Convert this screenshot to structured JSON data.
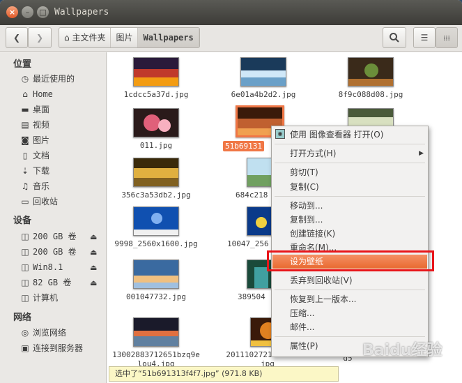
{
  "window": {
    "title": "Wallpapers"
  },
  "toolbar": {
    "breadcrumbs": [
      "主文件夹",
      "图片",
      "Wallpapers"
    ],
    "back_icon": "chevron-left-icon",
    "forward_icon": "chevron-right-icon",
    "search_icon": "search-icon"
  },
  "sidebar": {
    "places_heading": "位置",
    "places": [
      {
        "label": "最近使用的",
        "icon": "clock-icon"
      },
      {
        "label": "Home",
        "icon": "home-icon"
      },
      {
        "label": "桌面",
        "icon": "folder-icon"
      },
      {
        "label": "视频",
        "icon": "video-icon"
      },
      {
        "label": "图片",
        "icon": "camera-icon"
      },
      {
        "label": "文档",
        "icon": "document-icon"
      },
      {
        "label": "下载",
        "icon": "download-icon"
      },
      {
        "label": "音乐",
        "icon": "music-icon"
      },
      {
        "label": "回收站",
        "icon": "trash-icon"
      }
    ],
    "devices_heading": "设备",
    "devices": [
      {
        "label": "200 GB 卷",
        "icon": "drive-icon",
        "eject": true
      },
      {
        "label": "200 GB 卷",
        "icon": "drive-icon",
        "eject": true
      },
      {
        "label": "Win8.1",
        "icon": "drive-icon",
        "eject": true
      },
      {
        "label": "82 GB 卷",
        "icon": "drive-icon",
        "eject": true
      },
      {
        "label": "计算机",
        "icon": "drive-icon",
        "eject": false
      }
    ],
    "network_heading": "网络",
    "network": [
      {
        "label": "浏览网络",
        "icon": "network-icon"
      },
      {
        "label": "连接到服务器",
        "icon": "server-icon"
      }
    ]
  },
  "files": [
    {
      "name": "1cdcc5a37d.jpg",
      "colors": [
        "#2a1a3a",
        "#c0392b",
        "#f39c12"
      ]
    },
    {
      "name": "6e01a4b2d2.jpg",
      "colors": [
        "#1a3a5a",
        "#d0e8f8",
        "#6aa0c8"
      ]
    },
    {
      "name": "8f9c088d08.jpg",
      "colors": [
        "#3a2a1a",
        "#6b8e3a",
        "#b07030"
      ]
    },
    {
      "name": "011.jpg",
      "colors": [
        "#2a1a1a",
        "#e0607a",
        "#f7b0c0"
      ]
    },
    {
      "name": "51b691313f4f7.jpg",
      "display": "51b69131",
      "colors": [
        "#3a1a0a",
        "#c06030",
        "#f0a050"
      ]
    },
    {
      "name": "",
      "colors": [
        "#4a5a3a",
        "#d8e0c0",
        "#90a070"
      ]
    },
    {
      "name": "356c3a53db2.jpg",
      "colors": [
        "#3a2a0a",
        "#e0b040",
        "#806020"
      ]
    },
    {
      "name": "684c218",
      "colors": [
        "#5a8a5a",
        "#c0e0f0",
        "#70a060"
      ]
    },
    {
      "name": "9998_2560x1600.jpg",
      "colors": [
        "#1050b0",
        "#80b0f0",
        "#f0f0f0"
      ]
    },
    {
      "name": "10047_256",
      "colors": [
        "#0a3a8a",
        "#f0d040",
        "#2080c0"
      ]
    },
    {
      "name": "001047732.jpg",
      "colors": [
        "#3a6aa0",
        "#f0c080",
        "#a0c0e0"
      ]
    },
    {
      "name": "389504",
      "colors": [
        "#1a4a3a",
        "#40a0a0",
        "#a0d0c0"
      ]
    },
    {
      "name": "13002883712651bzq9e",
      "name2": "lou4.jpg",
      "colors": [
        "#1a1a2a",
        "#e07040",
        "#6080a0"
      ]
    },
    {
      "name": "20111027215959840.",
      "name2": "jpg",
      "colors": [
        "#3a1a0a",
        "#e08020",
        "#f0c040"
      ]
    },
    {
      "name": "d5",
      "colors": [
        "#2a2a2a",
        "#808080",
        "#c0c0c0"
      ]
    }
  ],
  "context_menu": {
    "items": [
      {
        "label": "使用 图像查看器 打开(O)",
        "icon": "image-viewer-icon"
      },
      {
        "label": "打开方式(H)",
        "submenu": true
      },
      {
        "label": "剪切(T)"
      },
      {
        "label": "复制(C)"
      },
      {
        "label": "移动到..."
      },
      {
        "label": "复制到..."
      },
      {
        "label": "创建链接(K)"
      },
      {
        "label": "重命名(M)..."
      },
      {
        "label": "设为壁纸"
      },
      {
        "label": "丢弃到回收站(V)"
      },
      {
        "label": "恢复到上一版本..."
      },
      {
        "label": "压缩..."
      },
      {
        "label": "邮件..."
      },
      {
        "label": "属性(P)"
      }
    ],
    "highlighted_index": 8
  },
  "status": {
    "text": "选中了“51b691313f4f7.jpg” (971.8 KB)"
  },
  "watermark": {
    "text": "Baidu经验"
  },
  "colors": {
    "accent": "#f07746",
    "highlight_box": "#e8151a"
  }
}
